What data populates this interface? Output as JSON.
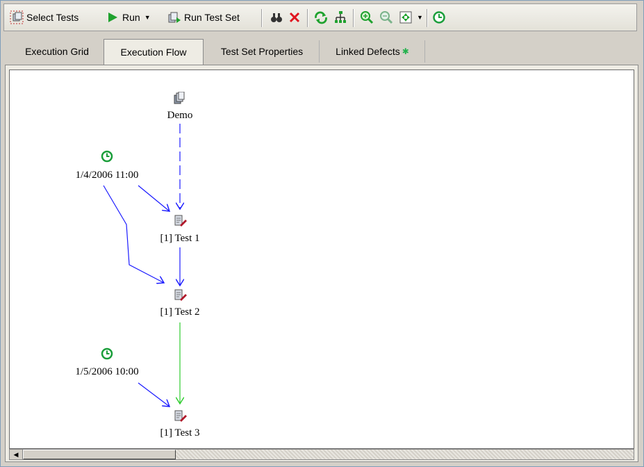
{
  "toolbar": {
    "select_tests": "Select Tests",
    "run": "Run",
    "run_test_set": "Run Test Set"
  },
  "tabs": [
    {
      "label": "Execution Grid",
      "active": false
    },
    {
      "label": "Execution Flow",
      "active": true
    },
    {
      "label": "Test Set Properties",
      "active": false
    },
    {
      "label": "Linked Defects",
      "active": false,
      "badge": "✱"
    }
  ],
  "flow": {
    "nodes": {
      "demo": "Demo",
      "time1": "1/4/2006 11:00",
      "test1": "[1] Test 1",
      "test2": "[1] Test 2",
      "time2": "1/5/2006 10:00",
      "test3": "[1] Test 3"
    }
  },
  "colors": {
    "link_blue": "#1a1aff",
    "link_green": "#2ecc2e",
    "clock_green": "#1a9e3a"
  },
  "icons": [
    "select-tests-icon",
    "run-icon",
    "run-test-set-icon",
    "find-icon",
    "delete-icon",
    "refresh-icon",
    "arrange-icon",
    "zoom-in-icon",
    "zoom-out-icon",
    "fit-window-icon",
    "time-dependency-icon"
  ]
}
